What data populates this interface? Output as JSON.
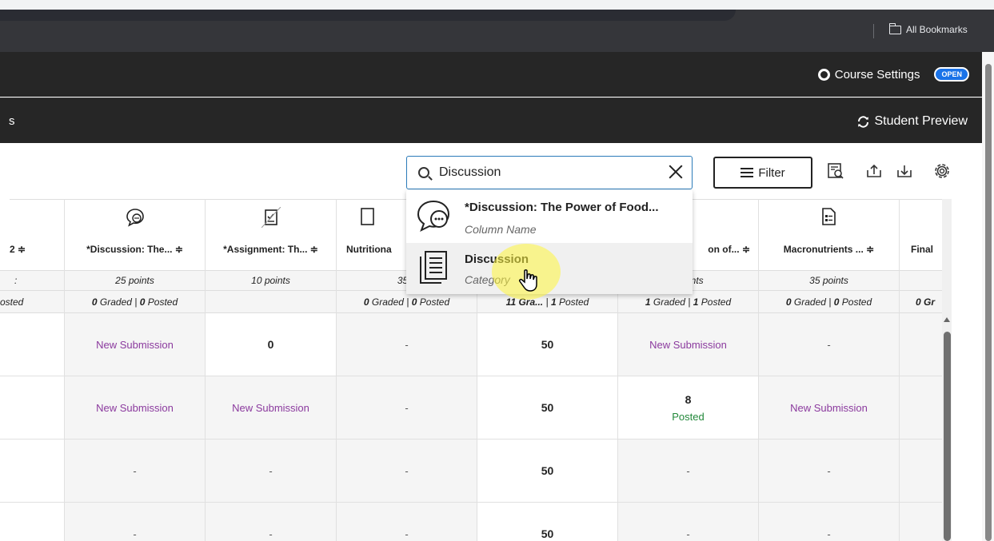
{
  "browser": {
    "bookmarks_label": "All Bookmarks"
  },
  "course_bar": {
    "settings_label": "Course Settings",
    "settings_badge": "OPEN"
  },
  "nav_bar": {
    "truncated_tab": "s",
    "student_preview_label": "Student Preview"
  },
  "toolbar": {
    "search_value": "Discussion",
    "filter_label": "Filter"
  },
  "search_dropdown": {
    "items": [
      {
        "title": "*Discussion: The Power of Food...",
        "subtitle": "Column Name",
        "icon": "discussion-icon"
      },
      {
        "title": "Discussion",
        "subtitle": "Category",
        "icon": "category-icon"
      }
    ]
  },
  "gradebook": {
    "columns": [
      {
        "name": "2 ≑",
        "points": ":",
        "graded": "osted",
        "icon": ""
      },
      {
        "name": "*Discussion: The... ≑",
        "points": "25 points",
        "graded_count": "0",
        "posted_count": "0",
        "icon": "discussion-icon"
      },
      {
        "name": "*Assignment: Th... ≑",
        "points": "10 points",
        "graded": "",
        "icon": "assignment-icon"
      },
      {
        "name": "Nutritiona",
        "points": "35 p",
        "graded_count": "0",
        "posted_count": "0",
        "icon": "document-icon"
      },
      {
        "name": "",
        "points": "",
        "graded_count": "11 Gra...",
        "posted_count": "1",
        "icon": ""
      },
      {
        "name": "on of... ≑",
        "points": "ints",
        "graded_count": "1",
        "posted_count": "1",
        "icon": "red-document-icon"
      },
      {
        "name": "Macronutrients ... ≑",
        "points": "35 points",
        "graded_count": "0",
        "posted_count": "0",
        "icon": "document-icon"
      },
      {
        "name": "Final",
        "points": "",
        "graded_count": "0 Gr",
        "icon": ""
      }
    ],
    "labels": {
      "graded": "Graded",
      "posted": "Posted",
      "sep": "|"
    },
    "rows": [
      [
        "",
        "New Submission",
        "0",
        "-",
        "50",
        "New Submission",
        "-",
        ""
      ],
      [
        "",
        "New Submission",
        "New Submission",
        "-",
        "50",
        "8",
        "New Submission",
        ""
      ],
      [
        "",
        "-",
        "-",
        "-",
        "50",
        "-",
        "-",
        ""
      ],
      [
        "",
        "-",
        "-",
        "-",
        "50",
        "-",
        "-",
        ""
      ]
    ],
    "row_extra": {
      "posted_label": "Posted"
    }
  }
}
